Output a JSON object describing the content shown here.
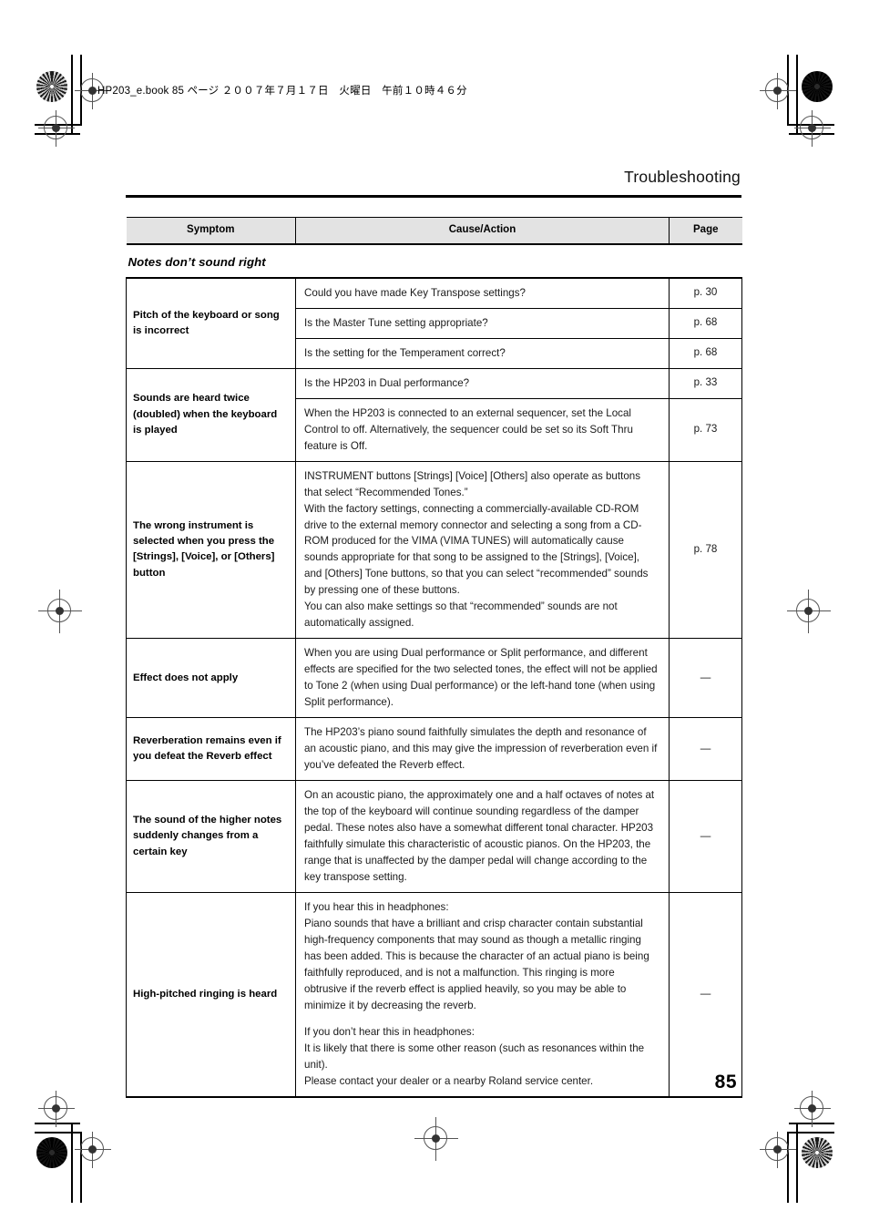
{
  "printer_slug": "HP203_e.book  85 ページ  ２００７年７月１７日　火曜日　午前１０時４６分",
  "running_head": "Troubleshooting",
  "folio": "85",
  "table": {
    "headers": {
      "symptom": "Symptom",
      "cause_action": "Cause/Action",
      "page": "Page"
    },
    "section_title": "Notes don’t sound right",
    "groups": [
      {
        "symptom": "Pitch of the keyboard or song is incorrect",
        "rows": [
          {
            "cause": [
              "Could you have made Key Transpose settings?"
            ],
            "page": "p. 30"
          },
          {
            "cause": [
              "Is the Master Tune setting appropriate?"
            ],
            "page": "p. 68"
          },
          {
            "cause": [
              "Is the setting for the Temperament correct?"
            ],
            "page": "p. 68"
          }
        ]
      },
      {
        "symptom": "Sounds are heard twice (doubled) when the keyboard is played",
        "rows": [
          {
            "cause": [
              "Is the HP203 in Dual performance?"
            ],
            "page": "p. 33"
          },
          {
            "cause": [
              "When the HP203 is connected to an external sequencer, set the Local Control to off. Alternatively, the sequencer could be set so its Soft Thru feature is Off."
            ],
            "page": "p. 73"
          }
        ]
      },
      {
        "symptom": "The wrong instrument is selected when you press the [Strings], [Voice], or [Others] button",
        "rows": [
          {
            "cause": [
              "INSTRUMENT buttons [Strings] [Voice] [Others] also operate as buttons that select “Recommended Tones.”",
              "With the factory settings, connecting a commercially-available CD-ROM drive to the external memory connector and selecting a song from a CD-ROM produced for the VIMA (VIMA TUNES) will automatically cause sounds appropriate for that song to be assigned to the [Strings], [Voice], and [Others] Tone buttons, so that you can select “recommended” sounds by pressing one of these buttons.",
              "You can also make settings so that “recommended” sounds are not automatically assigned."
            ],
            "page": "p. 78"
          }
        ]
      },
      {
        "symptom": "Effect does not apply",
        "rows": [
          {
            "cause": [
              "When you are using Dual performance or Split performance, and different effects are specified for the two selected tones, the effect will not be applied to Tone 2 (when using Dual performance) or the left-hand tone (when using Split performance)."
            ],
            "page": "—"
          }
        ]
      },
      {
        "symptom": "Reverberation remains even if you defeat the Reverb effect",
        "rows": [
          {
            "cause": [
              "The HP203’s piano sound faithfully simulates the depth and resonance of an acoustic piano, and this may give the impression of reverberation even if you’ve defeated the Reverb effect."
            ],
            "page": "—"
          }
        ]
      },
      {
        "symptom": "The sound of the higher notes suddenly changes from a certain key",
        "rows": [
          {
            "cause": [
              "On an acoustic piano, the approximately one and a half octaves of notes at the top of the keyboard will continue sounding regardless of the damper pedal. These notes also have a somewhat different tonal character. HP203 faithfully simulate this characteristic of acoustic pianos. On the HP203, the range that is unaffected by the damper pedal will change according to the key transpose setting."
            ],
            "page": "—"
          }
        ]
      },
      {
        "symptom": "High-pitched ringing is heard",
        "rows": [
          {
            "cause": [
              "If you hear this in headphones:",
              "Piano sounds that have a brilliant and crisp character contain substantial high-frequency components that may sound as though a metallic ringing has been added. This is because the character of an actual piano is being faithfully reproduced, and is not a malfunction. This ringing is more obtrusive if the reverb effect is applied heavily, so you may be able to minimize it by decreasing the reverb.",
              "__GAP__",
              "If you don’t hear this in headphones:",
              "It is likely that there is some other reason (such as resonances within the unit).",
              "Please contact your dealer or a nearby Roland service center."
            ],
            "page": "—"
          }
        ]
      }
    ]
  }
}
